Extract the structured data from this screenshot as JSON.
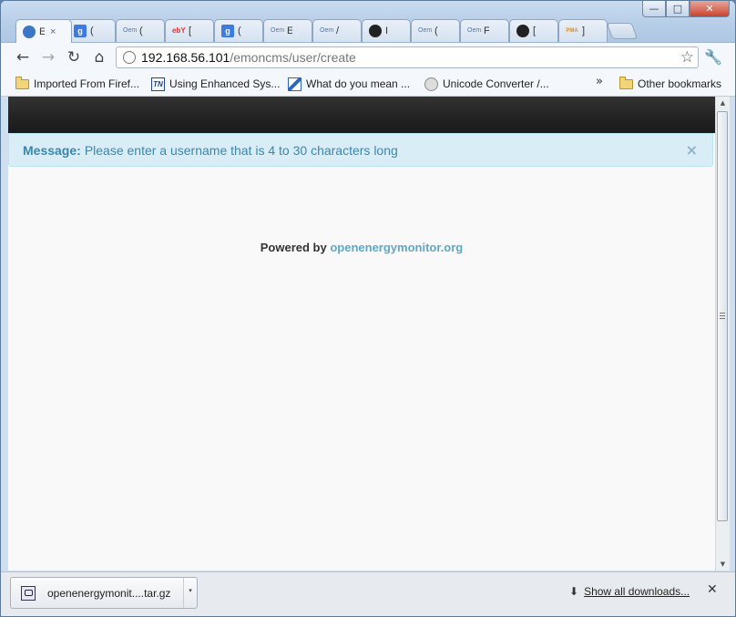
{
  "window": {
    "minimize": "—",
    "maximize": "□",
    "close": "✕"
  },
  "tabs": [
    {
      "label": "E",
      "icon": "emoncms-icon",
      "fav": "",
      "active": true,
      "close": "×"
    },
    {
      "label": "(",
      "icon": "google-icon",
      "fav": "g"
    },
    {
      "label": "(",
      "icon": "openenergymonitor-icon",
      "fav": "Oem"
    },
    {
      "label": "[",
      "icon": "ebay-icon",
      "fav": "ebY"
    },
    {
      "label": "(",
      "icon": "google-icon",
      "fav": "g"
    },
    {
      "label": "E",
      "icon": "openenergymonitor-icon",
      "fav": "Oem"
    },
    {
      "label": "/",
      "icon": "openenergymonitor-icon",
      "fav": "Oem"
    },
    {
      "label": "I",
      "icon": "github-icon",
      "fav": ""
    },
    {
      "label": "(",
      "icon": "openenergymonitor-icon",
      "fav": "Oem"
    },
    {
      "label": "F",
      "icon": "openenergymonitor-icon",
      "fav": "Oem"
    },
    {
      "label": "[",
      "icon": "github-icon",
      "fav": ""
    },
    {
      "label": "]",
      "icon": "phpmyadmin-icon",
      "fav": "PMA"
    }
  ],
  "toolbar": {
    "back": "←",
    "forward": "→",
    "reload": "↻",
    "home": "⌂",
    "url_host": "192.168.56.101",
    "url_path": "/emoncms/user/create",
    "star": "☆",
    "wrench": "🔧"
  },
  "bookmarks": {
    "items": [
      {
        "label": "Imported From Firef...",
        "icon": "folder-icon"
      },
      {
        "label": "Using Enhanced Sys...",
        "icon": "tn-icon"
      },
      {
        "label": "What do you mean ...",
        "icon": "bookmark-site-icon"
      },
      {
        "label": "Unicode Converter /...",
        "icon": "globe-icon"
      }
    ],
    "overflow": "»",
    "other": "Other bookmarks"
  },
  "page": {
    "alert_title": "Message:",
    "alert_text": "Please enter a username that is 4 to 30 characters long",
    "alert_close": "×",
    "powered_by": "Powered by",
    "powered_link": "openenergymonitor.org"
  },
  "downloads": {
    "file_name": "openenergymonit....tar.gz",
    "menu_arrow": "▾",
    "show_all": "Show all downloads...",
    "close": "✕"
  }
}
